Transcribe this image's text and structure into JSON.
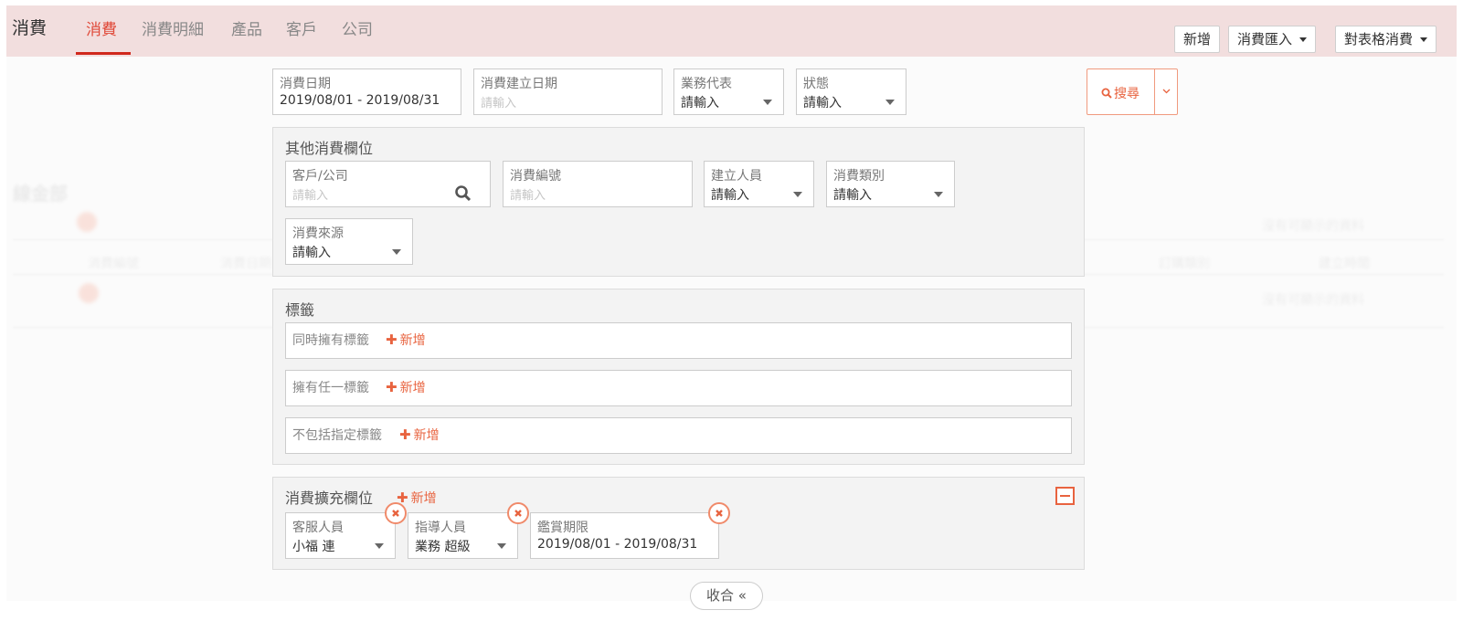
{
  "app": {
    "title": "消費"
  },
  "nav": {
    "tabs": [
      {
        "label": "消費"
      },
      {
        "label": "消費明細"
      },
      {
        "label": "產品"
      },
      {
        "label": "客戶"
      },
      {
        "label": "公司"
      }
    ]
  },
  "toolbar": {
    "new_label": "新增",
    "import_label": "消費匯入",
    "export_label": "對表格消費"
  },
  "background": {
    "title": "線金部",
    "no_data_1": "沒有可顯示的資料",
    "no_data_2": "沒有可顯示的資料",
    "col_1": "消費編號",
    "col_2": "消費日期",
    "col_3": "訂購類別",
    "col_4": "建立時間"
  },
  "filters": {
    "date": {
      "label": "消費日期",
      "value": "2019/08/01 - 2019/08/31"
    },
    "created_date": {
      "label": "消費建立日期",
      "placeholder": "請輸入"
    },
    "sales_rep": {
      "label": "業務代表",
      "value": "請輸入"
    },
    "status": {
      "label": "狀態",
      "value": "請輸入"
    }
  },
  "search": {
    "label": "搜尋"
  },
  "other_fields": {
    "title": "其他消費欄位",
    "customer": {
      "label": "客戶/公司",
      "placeholder": "請輸入"
    },
    "number": {
      "label": "消費編號",
      "placeholder": "請輸入"
    },
    "creator": {
      "label": "建立人員",
      "value": "請輸入"
    },
    "category": {
      "label": "消費類別",
      "value": "請輸入"
    },
    "source": {
      "label": "消費來源",
      "value": "請輸入"
    }
  },
  "tags": {
    "title": "標籤",
    "add_label": "新增",
    "rows": [
      {
        "label": "同時擁有標籤"
      },
      {
        "label": "擁有任一標籤"
      },
      {
        "label": "不包括指定標籤"
      }
    ]
  },
  "extended": {
    "title": "消費擴充欄位",
    "add_label": "新增",
    "fields": [
      {
        "label": "客服人員",
        "value": "小福 連"
      },
      {
        "label": "指導人員",
        "value": "業務 超級"
      },
      {
        "label": "鑑賞期限",
        "value": "2019/08/01 - 2019/08/31"
      }
    ]
  },
  "collapse": {
    "label": "收合 «"
  },
  "colors": {
    "accent": "#e8633f",
    "topbar": "#f2dede",
    "active_tab": "#d0281c"
  }
}
